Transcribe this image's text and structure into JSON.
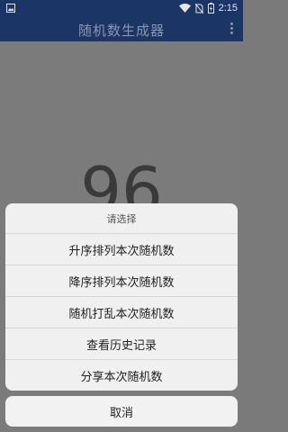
{
  "status_bar": {
    "time": "2:15",
    "icons": [
      "image-icon",
      "wifi-icon",
      "no-sim-icon",
      "battery-icon"
    ]
  },
  "app_bar": {
    "title": "随机数生成器",
    "menu_icon": "more-vert-icon"
  },
  "main": {
    "random_number": "96"
  },
  "action_sheet": {
    "header": "请选择",
    "items": [
      {
        "label": "升序排列本次随机数"
      },
      {
        "label": "降序排列本次随机数"
      },
      {
        "label": "随机打乱本次随机数"
      },
      {
        "label": "查看历史记录"
      },
      {
        "label": "分享本次随机数"
      }
    ],
    "cancel_label": "取消"
  },
  "colors": {
    "status_bar": "#1a3566",
    "overlay": "#7b7b7b",
    "sheet_bg": "#f0f0f0"
  }
}
